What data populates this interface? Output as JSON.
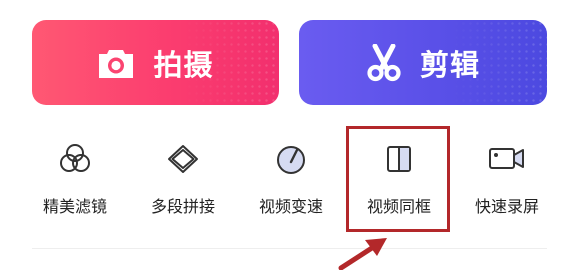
{
  "primary_actions": [
    {
      "label": "拍摄",
      "icon": "camera-icon",
      "color": "#fb3d6f"
    },
    {
      "label": "剪辑",
      "icon": "scissors-icon",
      "color": "#5a50e8"
    }
  ],
  "tools": [
    {
      "label": "精美滤镜",
      "icon": "filter-circles-icon"
    },
    {
      "label": "多段拼接",
      "icon": "diamond-layers-icon"
    },
    {
      "label": "视频变速",
      "icon": "speed-gauge-icon"
    },
    {
      "label": "视频同框",
      "icon": "split-frame-icon"
    },
    {
      "label": "快速录屏",
      "icon": "screen-record-icon"
    }
  ],
  "annotation": {
    "highlight_color": "#b3282a",
    "highlighted_tool": "视频同框"
  }
}
